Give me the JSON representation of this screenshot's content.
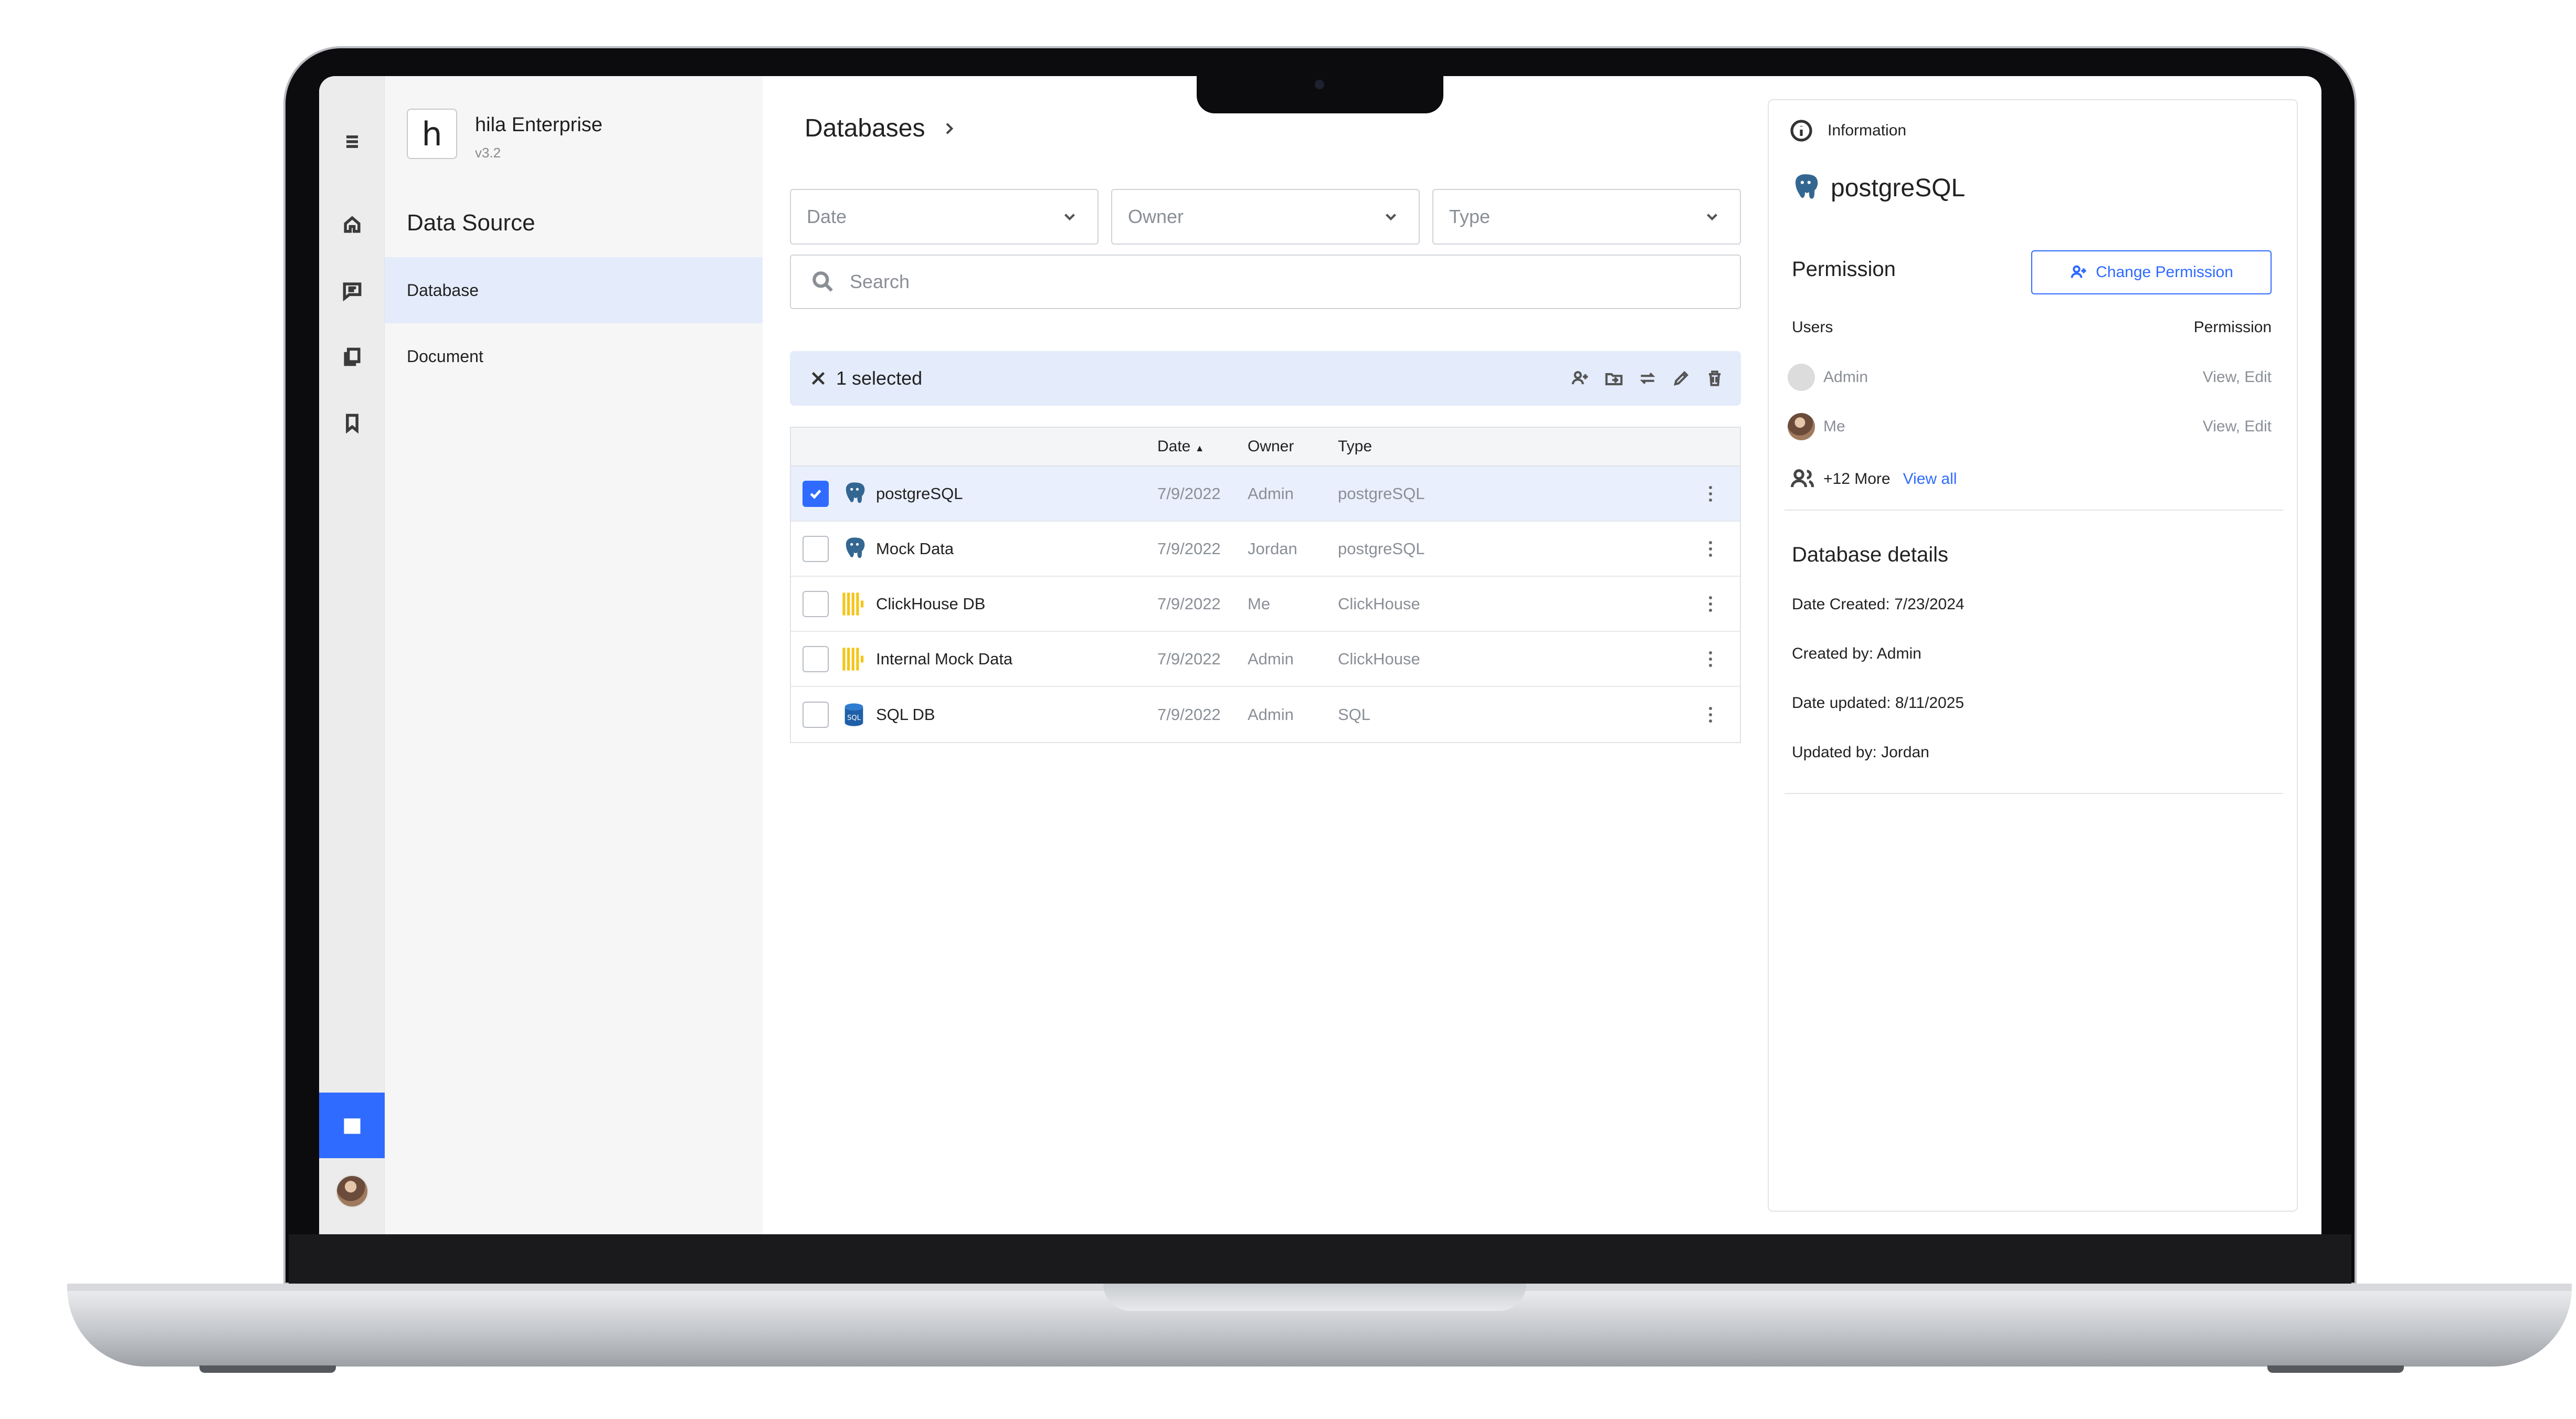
{
  "app": {
    "brand_logo_letter": "h",
    "brand_name": "hila Enterprise",
    "version": "v3.2"
  },
  "rail": {
    "items": [
      {
        "icon": "menu-icon"
      },
      {
        "icon": "home-icon"
      },
      {
        "icon": "chat-icon"
      },
      {
        "icon": "documents-icon"
      },
      {
        "icon": "bookmark-icon"
      },
      {
        "icon": "database-list-icon",
        "active": true
      }
    ]
  },
  "sidenav": {
    "title": "Data Source",
    "items": [
      {
        "label": "Database",
        "active": true
      },
      {
        "label": "Document",
        "active": false
      }
    ]
  },
  "main": {
    "breadcrumb": "Databases",
    "filters": [
      {
        "placeholder": "Date"
      },
      {
        "placeholder": "Owner"
      },
      {
        "placeholder": "Type"
      }
    ],
    "search_placeholder": "Search",
    "selection_text": "1 selected",
    "selection_actions": [
      "add-user-icon",
      "move-to-folder-icon",
      "transfer-icon",
      "edit-icon",
      "delete-icon"
    ],
    "table": {
      "headers": {
        "date": "Date",
        "owner": "Owner",
        "type": "Type"
      },
      "sort_indicator": "▲",
      "rows": [
        {
          "name": "postgreSQL",
          "date": "7/9/2022",
          "owner": "Admin",
          "type": "postgreSQL",
          "icon": "postgresql-icon",
          "selected": true
        },
        {
          "name": "Mock Data",
          "date": "7/9/2022",
          "owner": "Jordan",
          "type": "postgreSQL",
          "icon": "postgresql-icon",
          "selected": false
        },
        {
          "name": "ClickHouse DB",
          "date": "7/9/2022",
          "owner": "Me",
          "type": "ClickHouse",
          "icon": "clickhouse-icon",
          "selected": false
        },
        {
          "name": "Internal Mock Data",
          "date": "7/9/2022",
          "owner": "Admin",
          "type": "ClickHouse",
          "icon": "clickhouse-icon",
          "selected": false
        },
        {
          "name": "SQL DB",
          "date": "7/9/2022",
          "owner": "Admin",
          "type": "SQL",
          "icon": "sql-icon",
          "selected": false
        }
      ]
    }
  },
  "panel": {
    "header": "Information",
    "title": "postgreSQL",
    "permission_heading": "Permission",
    "change_permission_label": "Change Permission",
    "users_col": "Users",
    "permission_col": "Permission",
    "users": [
      {
        "name": "Admin",
        "permission": "View, Edit"
      },
      {
        "name": "Me",
        "permission": "View, Edit"
      }
    ],
    "more_count": "+12 More",
    "view_all": "View all",
    "details_heading": "Database details",
    "details": [
      "Date Created: 7/23/2024",
      "Created by: Admin",
      "Date updated: 8/11/2025",
      "Updated by: Jordan"
    ]
  },
  "colors": {
    "accent": "#2f6bff",
    "selected_bg": "#e4ebfb"
  }
}
